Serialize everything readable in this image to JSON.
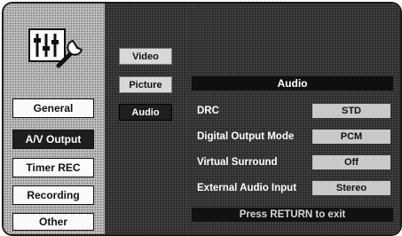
{
  "left_menu": {
    "icon": "tools-settings-icon",
    "items": [
      {
        "label": "General"
      },
      {
        "label": "A/V Output"
      },
      {
        "label": "Timer REC"
      },
      {
        "label": "Recording"
      },
      {
        "label": "Other"
      }
    ],
    "selected": "A/V Output"
  },
  "sub_menu": {
    "items": [
      {
        "label": "Video"
      },
      {
        "label": "Picture"
      },
      {
        "label": "Audio"
      }
    ],
    "selected": "Audio"
  },
  "audio_panel": {
    "title": "Audio",
    "rows": [
      {
        "label": "DRC",
        "value": "STD"
      },
      {
        "label": "Digital Output Mode",
        "value": "PCM"
      },
      {
        "label": "Virtual Surround",
        "value": "Off"
      },
      {
        "label": "External Audio Input",
        "value": "Stereo"
      }
    ],
    "footer": "Press RETURN to exit"
  }
}
